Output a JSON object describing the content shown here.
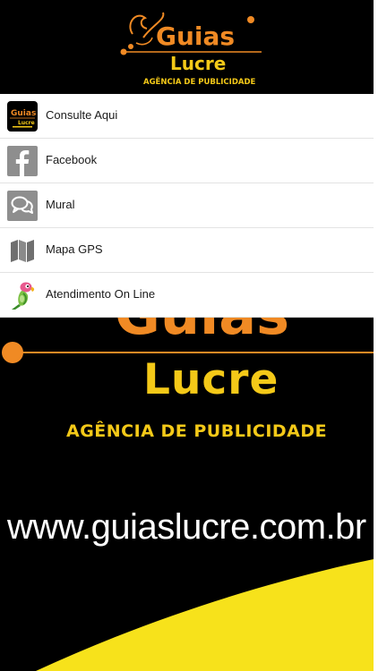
{
  "header": {
    "logo_brand": "Guias",
    "logo_sub": "Lucre",
    "logo_tagline": "AGÊNCIA DE PUBLICIDADE"
  },
  "menu": {
    "items": [
      {
        "label": "Consulte Aqui",
        "icon": "guias-lucre-logo-icon"
      },
      {
        "label": "Facebook",
        "icon": "facebook-icon"
      },
      {
        "label": "Mural",
        "icon": "chat-bubbles-icon"
      },
      {
        "label": "Mapa GPS",
        "icon": "map-icon"
      },
      {
        "label": "Atendimento On Line",
        "icon": "parrot-icon"
      }
    ]
  },
  "poster": {
    "partial_title": "Guias",
    "brand": "Lucre",
    "tagline": "AGÊNCIA DE PUBLICIDADE",
    "url": "www.guiaslucre.com.br"
  },
  "colors": {
    "brand_yellow": "#f4c918",
    "brand_orange": "#f08a24",
    "icon_gray": "#8e8e8e"
  }
}
